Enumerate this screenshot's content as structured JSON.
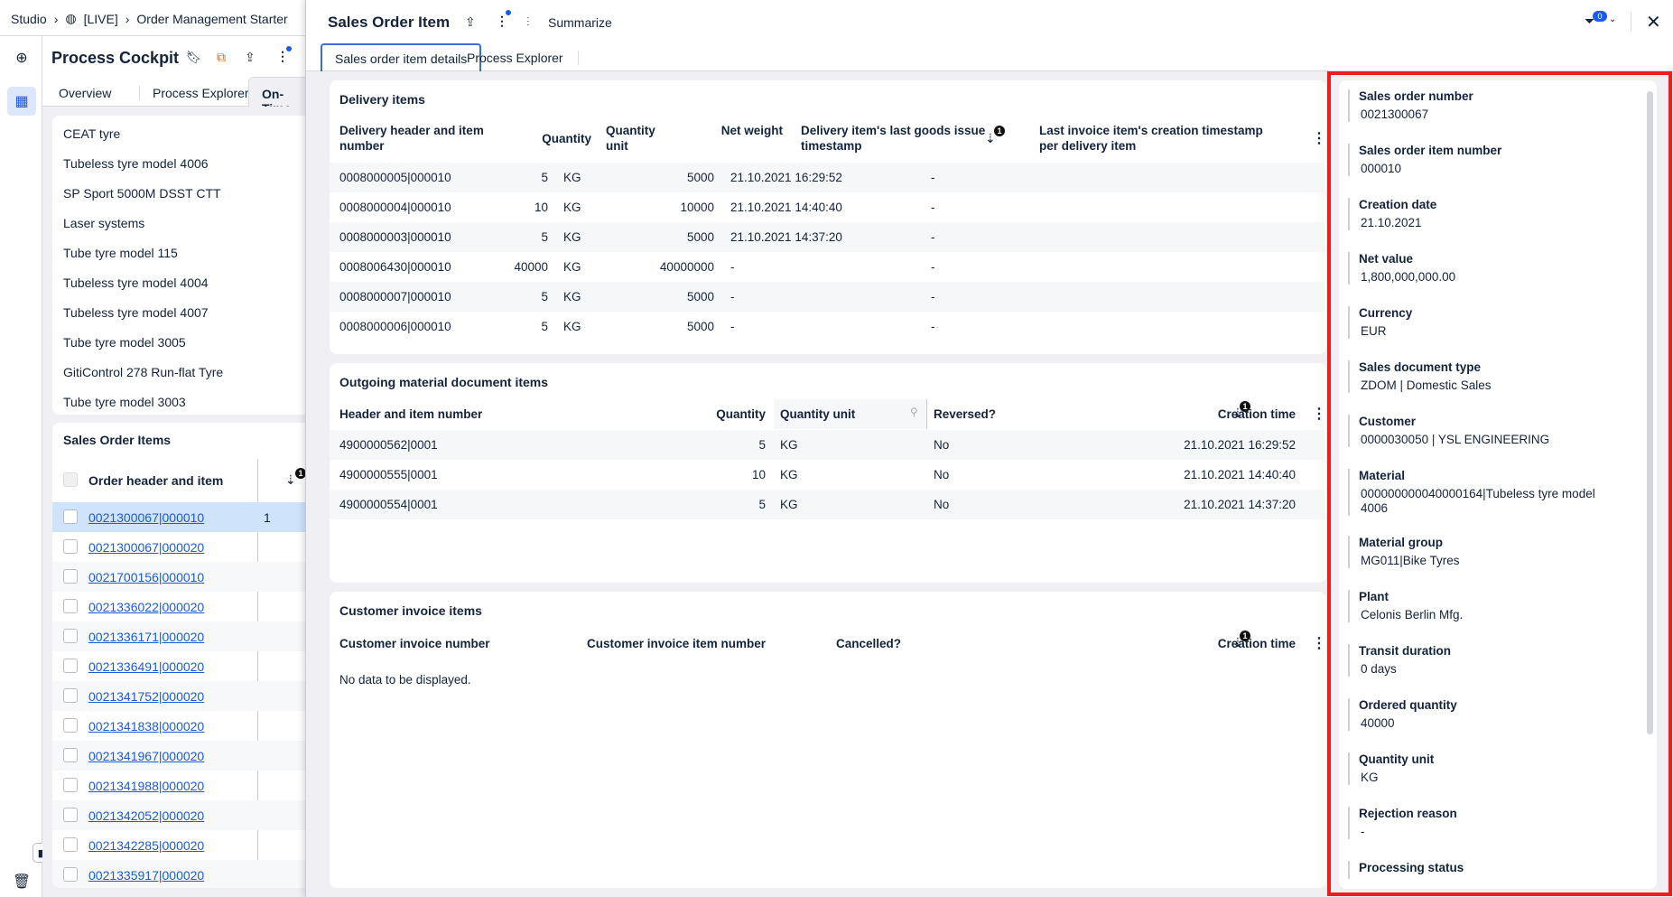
{
  "breadcrumb": {
    "items": [
      "Studio",
      "[LIVE]",
      "Order Management Starter"
    ]
  },
  "cockpit": {
    "title": "Process Cockpit",
    "tabs": [
      "Overview",
      "Process Explorer",
      "On-Time"
    ],
    "list": [
      "CEAT tyre",
      "Tubeless tyre model 4006",
      "SP Sport 5000M DSST CTT",
      "Laser systems",
      "Tube tyre model 115",
      "Tubeless tyre model 4004",
      "Tubeless tyre model 4007",
      "Tube tyre model 3005",
      "GitiControl 278 Run-flat Tyre",
      "Tube tyre model 3003"
    ]
  },
  "sales_order_items": {
    "title": "Sales Order Items",
    "header": "Order header and item",
    "sort_badge": "1",
    "first_row_value": "1",
    "rows": [
      "0021300067|000010",
      "0021300067|000020",
      "0021700156|000010",
      "0021336022|000020",
      "0021336171|000020",
      "0021336491|000020",
      "0021341752|000020",
      "0021341838|000020",
      "0021341967|000020",
      "0021341988|000020",
      "0021342052|000020",
      "0021342285|000020",
      "0021335917|000020"
    ]
  },
  "overlay": {
    "title": "Sales Order Item",
    "summarize": "Summarize",
    "filter_count": "0",
    "tabs": [
      "Sales order item details",
      "Process Explorer"
    ],
    "active_tab": 0
  },
  "delivery": {
    "title": "Delivery items",
    "headers": [
      "Delivery header and item number",
      "Quantity",
      "Quantity unit",
      "Net weight",
      "Delivery item's last goods issue timestamp",
      "Last invoice item's creation timestamp per delivery item"
    ],
    "sort_badge": "1",
    "rows": [
      [
        "0008000005|000010",
        "5",
        "KG",
        "5000",
        "21.10.2021 16:29:52",
        "-"
      ],
      [
        "0008000004|000010",
        "10",
        "KG",
        "10000",
        "21.10.2021 14:40:40",
        "-"
      ],
      [
        "0008000003|000010",
        "5",
        "KG",
        "5000",
        "21.10.2021 14:37:20",
        "-"
      ],
      [
        "0008006430|000010",
        "40000",
        "KG",
        "40000000",
        "-",
        "-"
      ],
      [
        "0008000007|000010",
        "5",
        "KG",
        "5000",
        "-",
        "-"
      ],
      [
        "0008000006|000010",
        "5",
        "KG",
        "5000",
        "-",
        "-"
      ]
    ]
  },
  "outgoing": {
    "title": "Outgoing material document items",
    "headers": [
      "Header and item number",
      "Quantity",
      "Quantity unit",
      "Reversed?",
      "Creation time"
    ],
    "sort_badge": "1",
    "rows": [
      [
        "4900000562|0001",
        "5",
        "KG",
        "No",
        "21.10.2021 16:29:52"
      ],
      [
        "4900000555|0001",
        "10",
        "KG",
        "No",
        "21.10.2021 14:40:40"
      ],
      [
        "4900000554|0001",
        "5",
        "KG",
        "No",
        "21.10.2021 14:37:20"
      ]
    ]
  },
  "invoice": {
    "title": "Customer invoice items",
    "headers": [
      "Customer invoice number",
      "Customer invoice item number",
      "Cancelled?",
      "Creation time"
    ],
    "sort_badge": "1",
    "empty": "No data to be displayed."
  },
  "details": [
    {
      "label": "Sales order number",
      "value": "0021300067"
    },
    {
      "label": "Sales order item number",
      "value": "000010"
    },
    {
      "label": "Creation date",
      "value": "21.10.2021"
    },
    {
      "label": "Net value",
      "value": "1,800,000,000.00"
    },
    {
      "label": "Currency",
      "value": "EUR"
    },
    {
      "label": "Sales document type",
      "value": "ZDOM | Domestic Sales"
    },
    {
      "label": "Customer",
      "value": "0000030050 | YSL ENGINEERING"
    },
    {
      "label": "Material",
      "value": "000000000040000164|Tubeless tyre model 4006"
    },
    {
      "label": "Material group",
      "value": "MG011|Bike Tyres"
    },
    {
      "label": "Plant",
      "value": "Celonis Berlin Mfg."
    },
    {
      "label": "Transit duration",
      "value": "0 days"
    },
    {
      "label": "Ordered quantity",
      "value": "40000"
    },
    {
      "label": "Quantity unit",
      "value": "KG"
    },
    {
      "label": "Rejection reason",
      "value": "-"
    },
    {
      "label": "Processing status",
      "value": ""
    }
  ],
  "colors": {
    "link": "#1c5bd9",
    "highlight": "#cfe3fb",
    "annotation_border": "#ee1c1c",
    "notification_dot": "#1a5cf0"
  }
}
